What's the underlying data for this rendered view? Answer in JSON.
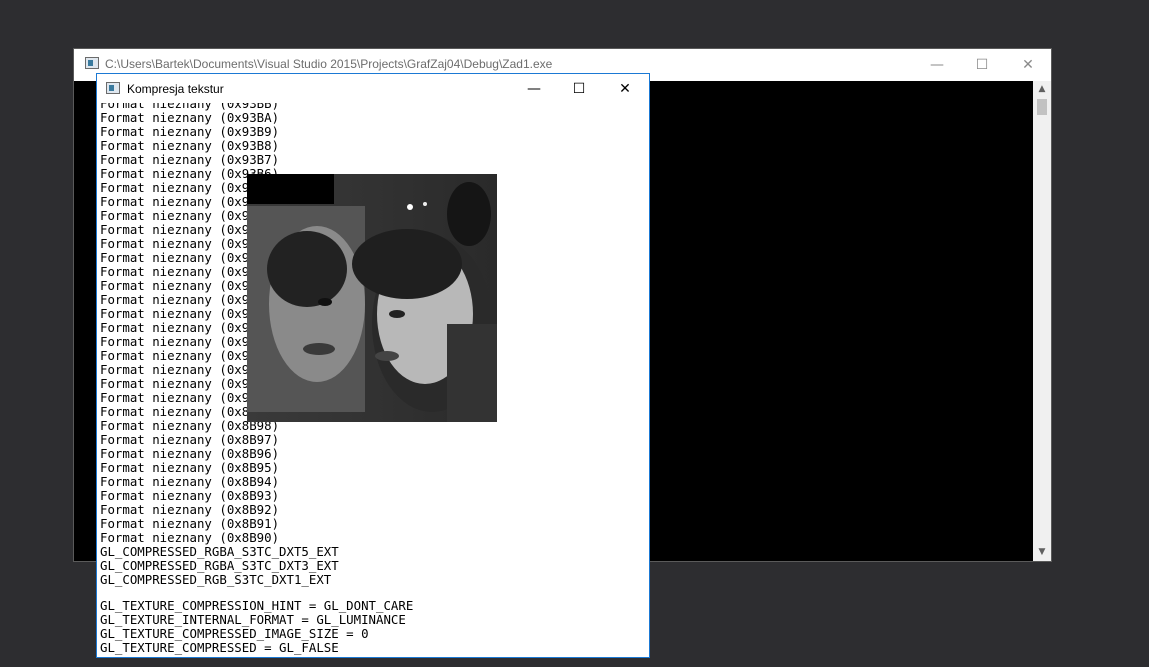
{
  "console_window": {
    "title": "C:\\Users\\Bartek\\Documents\\Visual Studio 2015\\Projects\\GrafZaj04\\Debug\\Zad1.exe",
    "minimize": "—",
    "maximize": "☐",
    "close": "✕",
    "scroll_up": "▲",
    "scroll_down": "▼"
  },
  "gl_window": {
    "title": "Kompresja tekstur",
    "minimize": "—",
    "maximize": "☐",
    "close": "✕"
  },
  "lines": [
    "Format nieznany (0x93BB)",
    "Format nieznany (0x93BA)",
    "Format nieznany (0x93B9)",
    "Format nieznany (0x93B8)",
    "Format nieznany (0x93B7)",
    "Format nieznany (0x93B6)",
    "Format nieznany (0x93B5)",
    "Format nieznany (0x93B4)",
    "Format nieznany (0x93B3)",
    "Format nieznany (0x93B2)",
    "Format nieznany (0x93B1)",
    "Format nieznany (0x93B0)",
    "Format nieznany (0x9273)",
    "Format nieznany (0x9272)",
    "Format nieznany (0x9271)",
    "Format nieznany (0x9270)",
    "Format nieznany (0x9279)",
    "Format nieznany (0x9278)",
    "Format nieznany (0x9277)",
    "Format nieznany (0x9276)",
    "Format nieznany (0x9275)",
    "Format nieznany (0x9274)",
    "Format nieznany (0x8B99)",
    "Format nieznany (0x8B98)",
    "Format nieznany (0x8B97)",
    "Format nieznany (0x8B96)",
    "Format nieznany (0x8B95)",
    "Format nieznany (0x8B94)",
    "Format nieznany (0x8B93)",
    "Format nieznany (0x8B92)",
    "Format nieznany (0x8B91)",
    "Format nieznany (0x8B90)",
    "GL_COMPRESSED_RGBA_S3TC_DXT5_EXT",
    "GL_COMPRESSED_RGBA_S3TC_DXT3_EXT",
    "GL_COMPRESSED_RGB_S3TC_DXT1_EXT",
    "",
    "GL_TEXTURE_COMPRESSION_HINT = GL_DONT_CARE",
    "GL_TEXTURE_INTERNAL_FORMAT = GL_LUMINANCE",
    "GL_TEXTURE_COMPRESSED_IMAGE_SIZE = 0",
    "GL_TEXTURE_COMPRESSED = GL_FALSE"
  ],
  "texture_image": {
    "description_icon": "grayscale-photo-two-faces"
  }
}
